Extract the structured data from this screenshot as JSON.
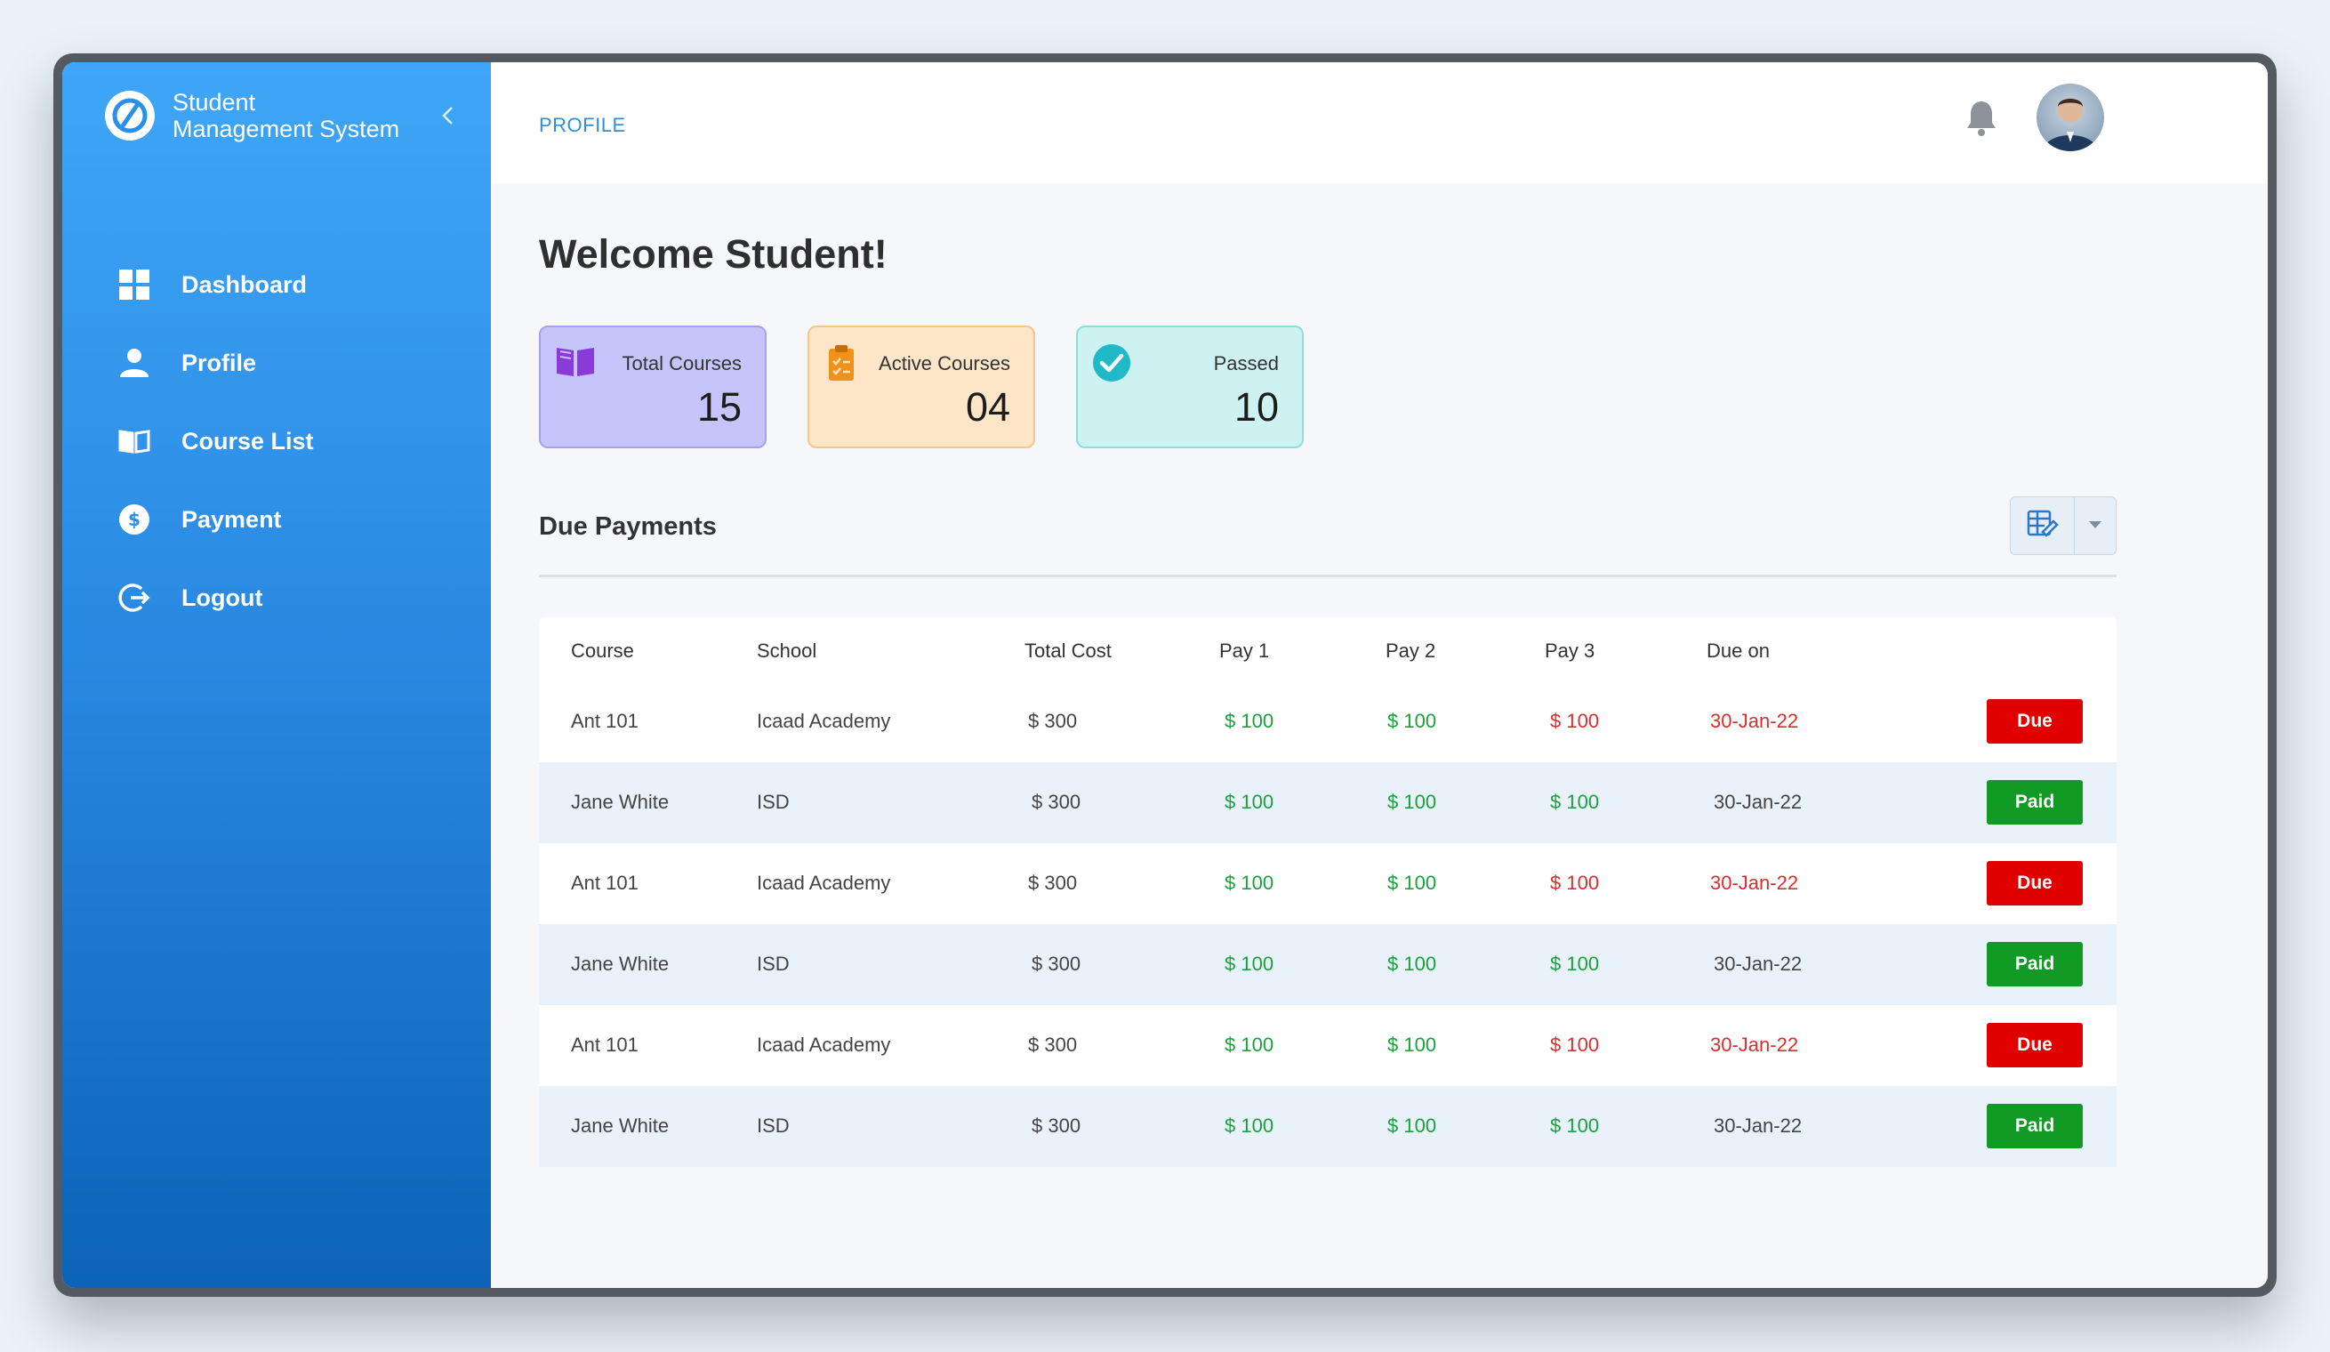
{
  "brand": {
    "line1": "Student",
    "line2": "Management System"
  },
  "nav": [
    {
      "label": "Dashboard",
      "icon": "dashboard-grid-icon"
    },
    {
      "label": "Profile",
      "icon": "user-icon"
    },
    {
      "label": "Course List",
      "icon": "book-open-icon"
    },
    {
      "label": "Payment",
      "icon": "dollar-coin-icon"
    },
    {
      "label": "Logout",
      "icon": "logout-icon"
    }
  ],
  "header": {
    "breadcrumb": "PROFILE"
  },
  "welcome": "Welcome Student!",
  "cards": [
    {
      "label": "Total Courses",
      "value": "15",
      "icon": "book-icon"
    },
    {
      "label": "Active Courses",
      "value": "04",
      "icon": "clipboard-icon"
    },
    {
      "label": "Passed",
      "value": "10",
      "icon": "check-circle-icon"
    }
  ],
  "section_title": "Due Payments",
  "table": {
    "headers": [
      "Course",
      "School",
      "Total Cost",
      "Pay 1",
      "Pay 2",
      "Pay 3",
      "Due on"
    ],
    "rows": [
      {
        "course": "Ant 101",
        "school": "Icaad Academy",
        "total": "$ 300",
        "pay1": "$ 100",
        "pay2": "$ 100",
        "pay3": "$ 100",
        "due_on": "30-Jan-22",
        "status": "Due"
      },
      {
        "course": "Jane White",
        "school": "ISD",
        "total": "$ 300",
        "pay1": "$ 100",
        "pay2": "$ 100",
        "pay3": "$ 100",
        "due_on": "30-Jan-22",
        "status": "Paid"
      },
      {
        "course": "Ant 101",
        "school": "Icaad Academy",
        "total": "$ 300",
        "pay1": "$ 100",
        "pay2": "$ 100",
        "pay3": "$ 100",
        "due_on": "30-Jan-22",
        "status": "Due"
      },
      {
        "course": "Jane White",
        "school": "ISD",
        "total": "$ 300",
        "pay1": "$ 100",
        "pay2": "$ 100",
        "pay3": "$ 100",
        "due_on": "30-Jan-22",
        "status": "Paid"
      },
      {
        "course": "Ant 101",
        "school": "Icaad Academy",
        "total": "$ 300",
        "pay1": "$ 100",
        "pay2": "$ 100",
        "pay3": "$ 100",
        "due_on": "30-Jan-22",
        "status": "Due"
      },
      {
        "course": "Jane White",
        "school": "ISD",
        "total": "$ 300",
        "pay1": "$ 100",
        "pay2": "$ 100",
        "pay3": "$ 100",
        "due_on": "30-Jan-22",
        "status": "Paid"
      }
    ]
  },
  "colors": {
    "sidebar_top": "#3fa6f7",
    "sidebar_bottom": "#0c63b7",
    "paid": "#119a24",
    "due": "#e00000",
    "accent": "#2d8fe0"
  }
}
